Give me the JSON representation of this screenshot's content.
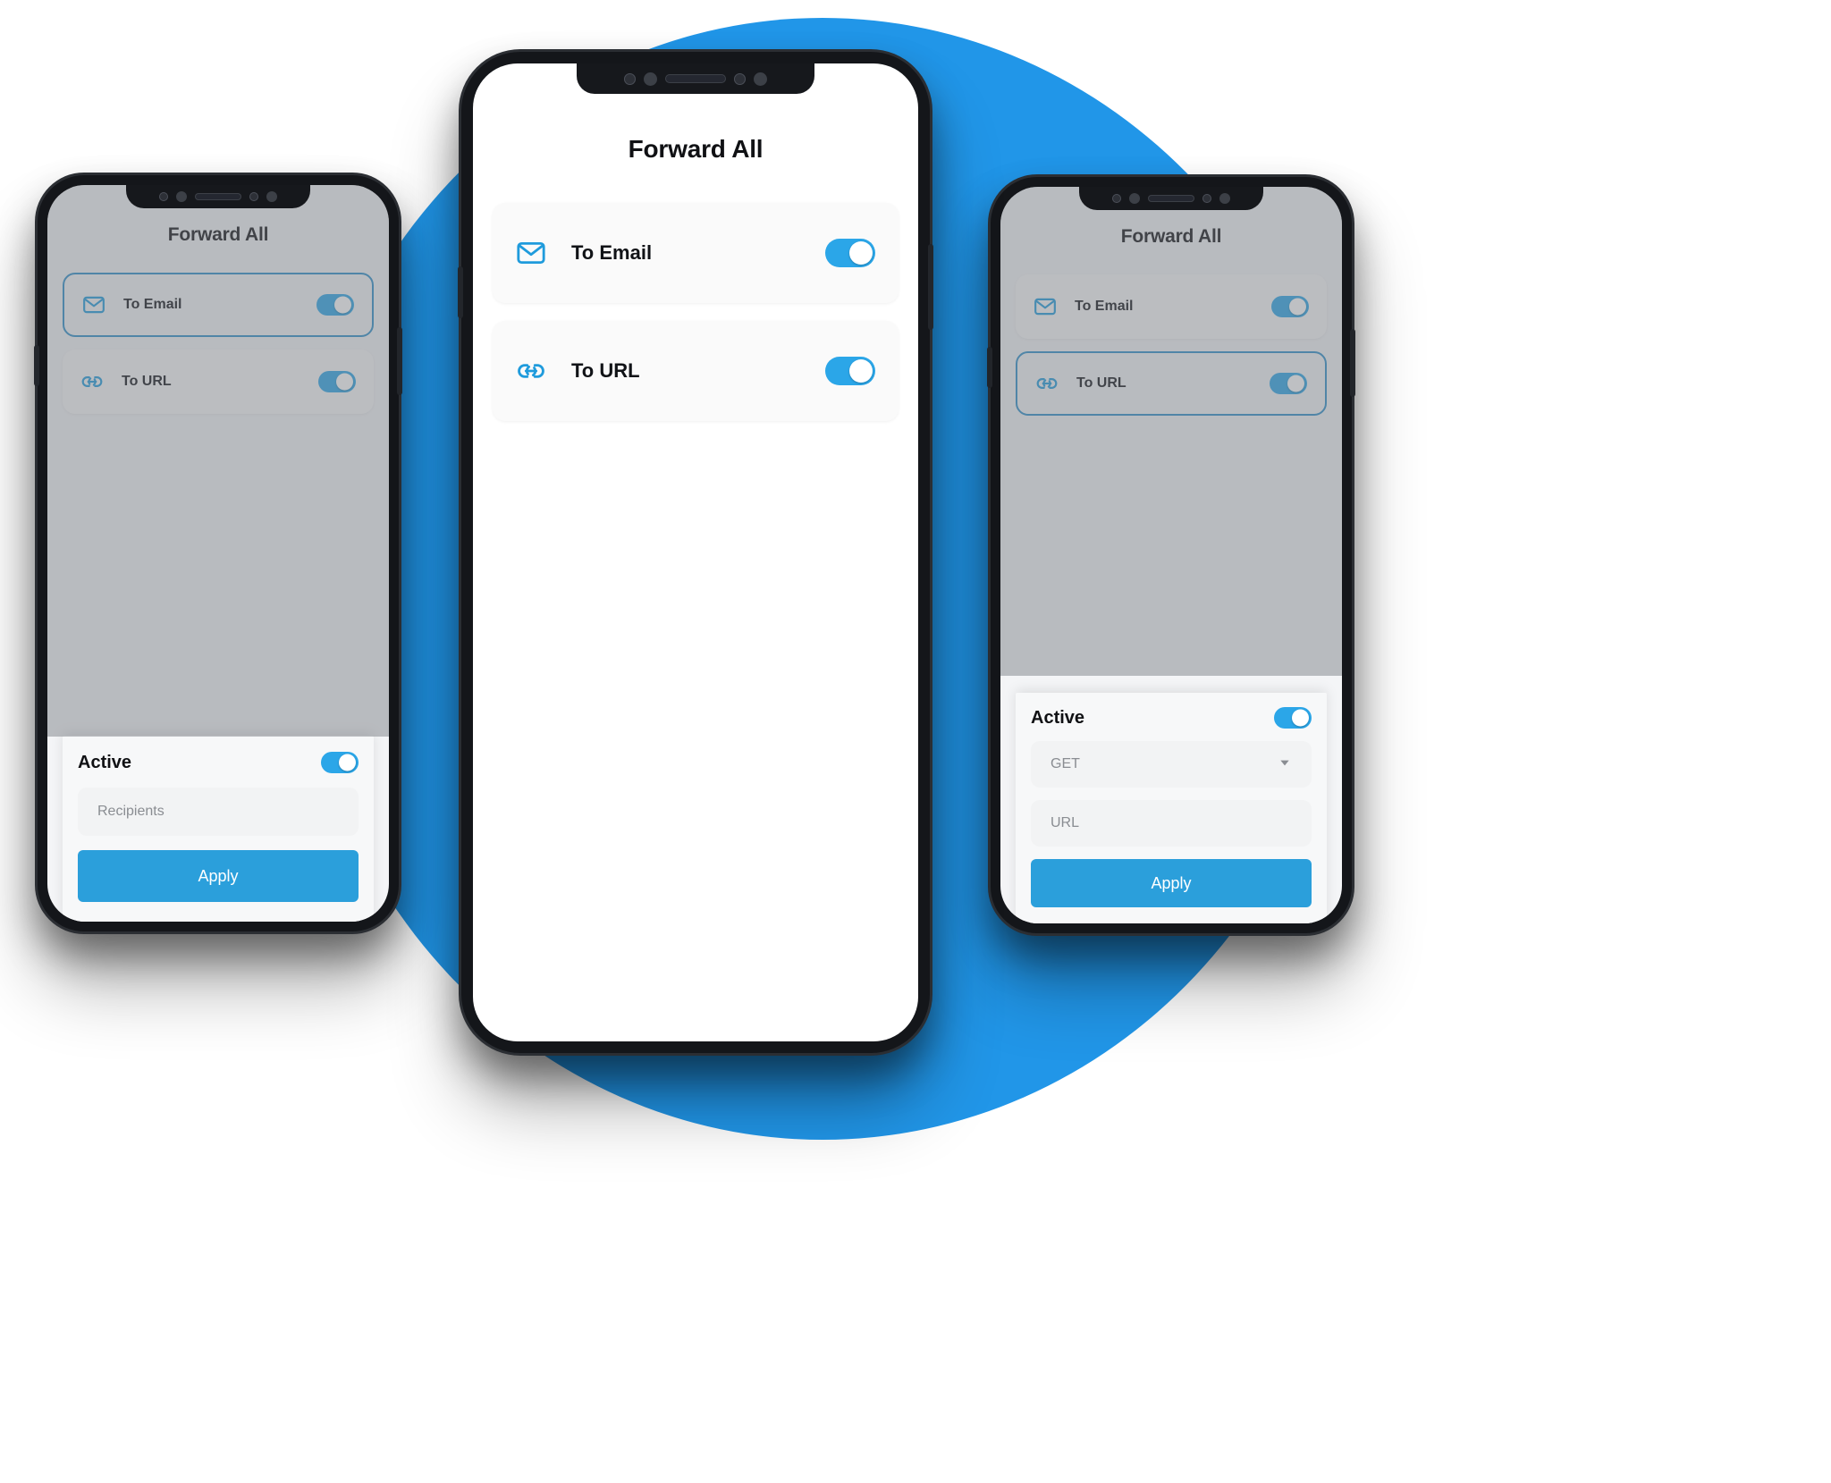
{
  "theme": {
    "accent": "#2b9fdb",
    "backdrop_circle": "#2196e8",
    "icon_blue": "#1f9bdc",
    "toggle_on": "#2ba6e8",
    "selected_border": "#2d8fc9",
    "text_dark": "#101114",
    "placeholder_gray": "#8a8d92"
  },
  "app": {
    "title": "Forward All"
  },
  "rows": {
    "email": {
      "label": "To Email",
      "icon": "envelope-icon",
      "toggle_on": true
    },
    "url": {
      "label": "To URL",
      "icon": "link-icon",
      "toggle_on": true
    }
  },
  "phones": [
    {
      "id": "left",
      "title": "Forward All",
      "selected_row": "email",
      "rows": [
        {
          "label": "To Email",
          "icon": "envelope-icon",
          "toggle": "on",
          "selected": true
        },
        {
          "label": "To URL",
          "icon": "link-icon",
          "toggle": "on",
          "selected": false
        }
      ],
      "sheet": {
        "title": "Active",
        "toggle": "on",
        "fields": [
          {
            "name": "recipients",
            "placeholder": "Recipients",
            "value": "",
            "type": "text"
          }
        ],
        "apply_label": "Apply"
      }
    },
    {
      "id": "center",
      "title": "Forward All",
      "selected_row": null,
      "rows": [
        {
          "label": "To Email",
          "icon": "envelope-icon",
          "toggle": "on",
          "selected": false
        },
        {
          "label": "To URL",
          "icon": "link-icon",
          "toggle": "on",
          "selected": false
        }
      ],
      "sheet": null
    },
    {
      "id": "right",
      "title": "Forward All",
      "selected_row": "url",
      "rows": [
        {
          "label": "To Email",
          "icon": "envelope-icon",
          "toggle": "on",
          "selected": false
        },
        {
          "label": "To URL",
          "icon": "link-icon",
          "toggle": "on",
          "selected": true
        }
      ],
      "sheet": {
        "title": "Active",
        "toggle": "on",
        "fields": [
          {
            "name": "method",
            "placeholder": "GET",
            "value": "GET",
            "type": "select",
            "caret": "chevron-down-icon"
          },
          {
            "name": "url",
            "placeholder": "URL",
            "value": "",
            "type": "text"
          }
        ],
        "apply_label": "Apply"
      }
    }
  ]
}
